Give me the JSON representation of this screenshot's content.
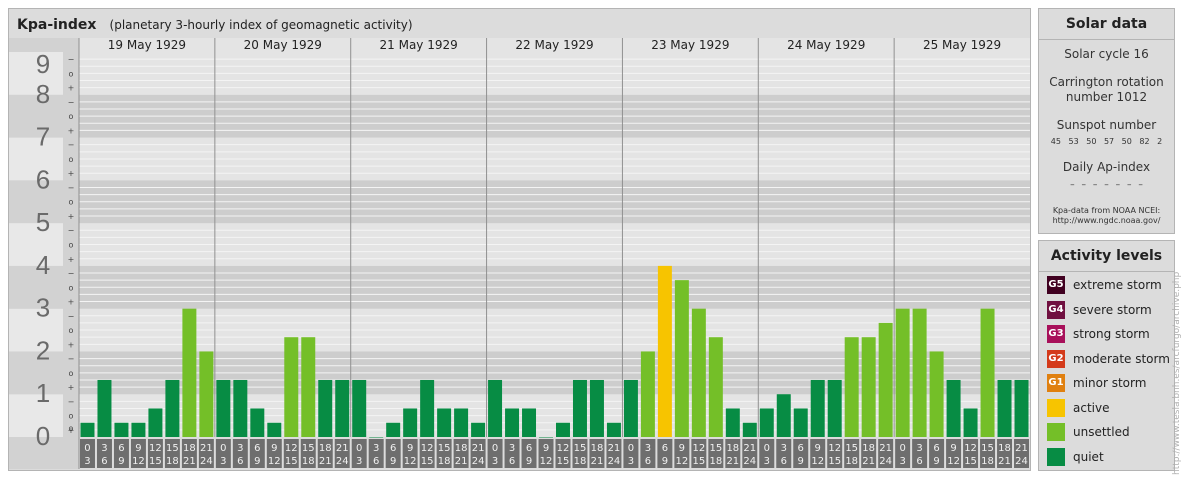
{
  "chart_data": {
    "type": "bar",
    "title": "Kpa-index",
    "subtitle": "(planetary 3-hourly index of geomagnetic activity)",
    "ylim": [
      0,
      9
    ],
    "y_ticks": [
      "0",
      "1",
      "2",
      "3",
      "4",
      "5",
      "6",
      "7",
      "8",
      "9"
    ],
    "sub_ticks": [
      "+",
      "o",
      "−"
    ],
    "days": [
      "19 May 1929",
      "20 May 1929",
      "21 May 1929",
      "22 May 1929",
      "23 May 1929",
      "24 May 1929",
      "25 May 1929"
    ],
    "hour_start_labels": [
      "0",
      "3",
      "6",
      "9",
      "12",
      "15",
      "18",
      "21"
    ],
    "hour_end_labels": [
      "3",
      "6",
      "9",
      "12",
      "15",
      "18",
      "21",
      "24"
    ],
    "values": [
      [
        0.333,
        1.333,
        0.333,
        0.333,
        0.667,
        1.333,
        3.0,
        2.0
      ],
      [
        1.333,
        1.333,
        0.667,
        0.333,
        2.333,
        2.333,
        1.333,
        1.333
      ],
      [
        1.333,
        0.0,
        0.333,
        0.667,
        1.333,
        0.667,
        0.667,
        0.333
      ],
      [
        1.333,
        0.667,
        0.667,
        0.0,
        0.333,
        1.333,
        1.333,
        0.333
      ],
      [
        1.333,
        2.0,
        4.0,
        3.667,
        3.0,
        2.333,
        0.667,
        0.333
      ],
      [
        0.667,
        1.0,
        0.667,
        1.333,
        1.333,
        2.333,
        2.333,
        2.667
      ],
      [
        3.0,
        3.0,
        2.0,
        1.333,
        0.667,
        3.0,
        1.333,
        1.333
      ]
    ],
    "level_colors": {
      "quiet": "#078c44",
      "unsettled": "#74bf28",
      "active": "#f7c400",
      "minor": "#e08010",
      "moderate": "#d43a1a",
      "strong": "#a8105a",
      "severe": "#701040",
      "extreme": "#400020"
    },
    "grid": true,
    "legend_position": "right"
  },
  "solar": {
    "heading": "Solar data",
    "cycle": "Solar cycle 16",
    "carrington_line1": "Carrington rotation",
    "carrington_line2": "number 1012",
    "sunspot_title": "Sunspot number",
    "sunspot_values": "45 53 50 57 50 82 2",
    "ap_title": "Daily Ap-index",
    "ap_values": "– – – – – – –",
    "source_line1": "Kpa-data from NOAA NCEI:",
    "source_line2": "http://www.ngdc.noaa.gov/"
  },
  "activity": {
    "heading": "Activity levels",
    "levels": [
      {
        "badge": "G5",
        "label": "extreme storm",
        "color": "#400020"
      },
      {
        "badge": "G4",
        "label": "severe storm",
        "color": "#701040"
      },
      {
        "badge": "G3",
        "label": "strong storm",
        "color": "#a8105a"
      },
      {
        "badge": "G2",
        "label": "moderate storm",
        "color": "#d43a1a"
      },
      {
        "badge": "G1",
        "label": "minor storm",
        "color": "#e08010"
      },
      {
        "badge": "",
        "label": "active",
        "color": "#f7c400"
      },
      {
        "badge": "",
        "label": "unsettled",
        "color": "#74bf28"
      },
      {
        "badge": "",
        "label": "quiet",
        "color": "#078c44"
      }
    ]
  },
  "watermark": "http://www.tesla.bnh.es/arcfurgo/archive.php"
}
